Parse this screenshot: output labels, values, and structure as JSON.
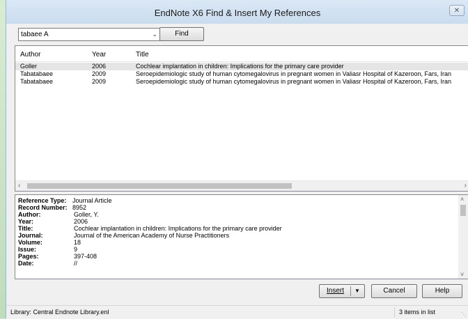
{
  "window": {
    "title": "EndNote X6 Find & Insert My References",
    "close_glyph": "✕"
  },
  "search": {
    "value": "tabaee A",
    "find_label": "Find"
  },
  "list": {
    "headers": {
      "author": "Author",
      "year": "Year",
      "title": "Title"
    },
    "rows": [
      {
        "author": "Goller",
        "year": "2006",
        "title": "Cochlear implantation in children: Implications for the primary care provider"
      },
      {
        "author": "Tabatabaee",
        "year": "2009",
        "title": "Seroepidemiologic study of human cytomegalovirus in pregnant women in Valiasr Hospital of Kazeroon, Fars, Iran"
      },
      {
        "author": "Tabatabaee",
        "year": "2009",
        "title": "Seroepidemiologic study of human cytomegalovirus in pregnant women in Valiasr Hospital of Kazeroon, Fars, Iran"
      }
    ]
  },
  "detail": {
    "reference_type": {
      "label": "Reference Type:",
      "value": "Journal Article"
    },
    "record_number": {
      "label": "Record Number:",
      "value": "8952"
    },
    "fields": [
      {
        "label": "Author:",
        "value": "Goller, Y."
      },
      {
        "label": "Year:",
        "value": "2006"
      },
      {
        "label": "Title:",
        "value": "Cochlear implantation in children: Implications for the primary care provider"
      },
      {
        "label": "Journal:",
        "value": "Journal of the American Academy of Nurse Practitioners"
      },
      {
        "label": "Volume:",
        "value": "18"
      },
      {
        "label": "Issue:",
        "value": "9"
      },
      {
        "label": "Pages:",
        "value": "397-408"
      },
      {
        "label": "Date:",
        "value": "//"
      }
    ]
  },
  "buttons": {
    "insert": "Insert",
    "cancel": "Cancel",
    "help": "Help"
  },
  "status": {
    "library": "Library: Central Endnote Library.enl",
    "count": "3 items in list"
  }
}
